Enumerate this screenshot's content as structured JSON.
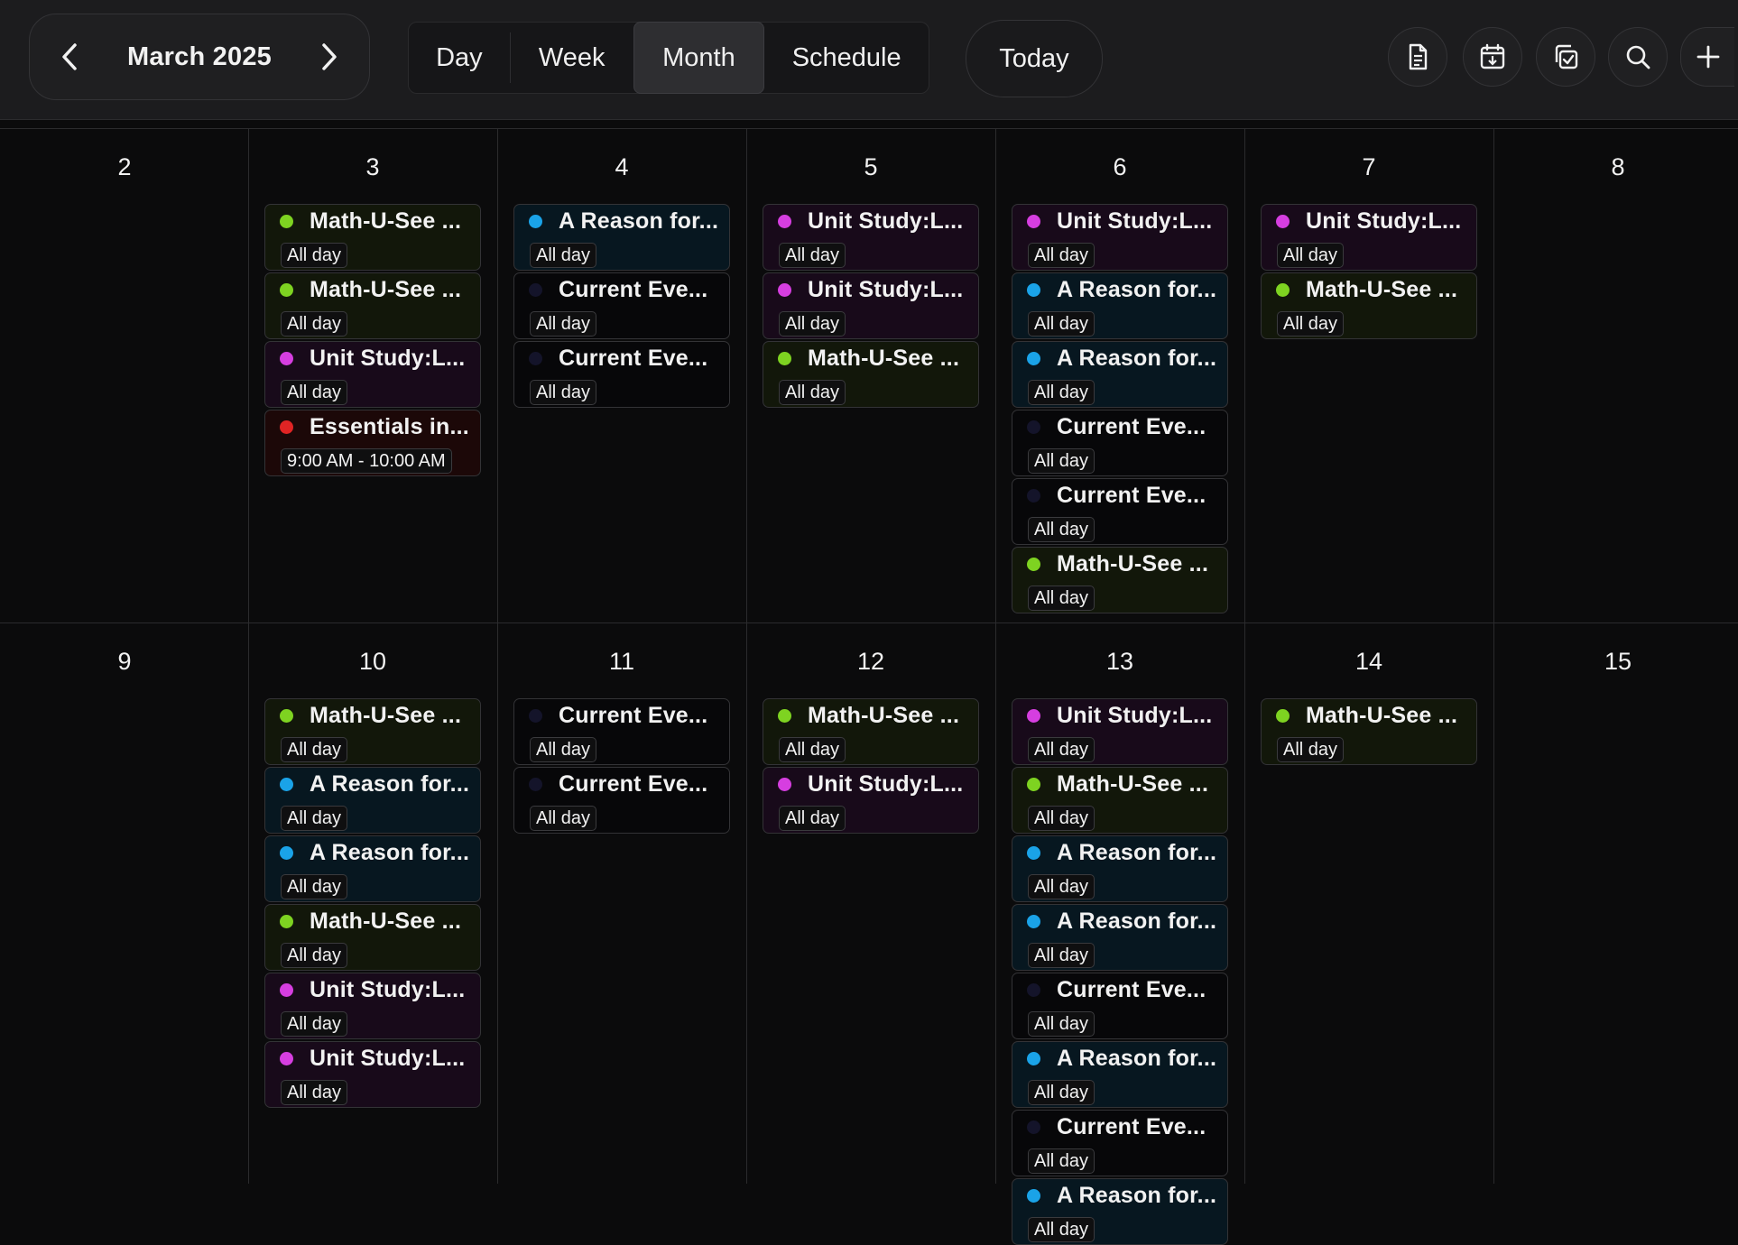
{
  "header": {
    "month_title": "March 2025",
    "views": [
      {
        "label": "Day",
        "active": false
      },
      {
        "label": "Week",
        "active": false
      },
      {
        "label": "Month",
        "active": true
      },
      {
        "label": "Schedule",
        "active": false
      }
    ],
    "today_label": "Today",
    "icons": [
      "document-icon",
      "calendar-import-icon",
      "copy-check-icon",
      "search-icon",
      "plus-icon"
    ]
  },
  "colors": {
    "green": "#7ed321",
    "blue": "#1aa3e8",
    "purple": "#d63ee0",
    "dark": "#14142a",
    "red": "#e02424"
  },
  "weeks": [
    {
      "days": [
        {
          "num": "2",
          "events": []
        },
        {
          "num": "3",
          "events": [
            {
              "title": "Math-U-See ...",
              "time": "All day",
              "color": "green"
            },
            {
              "title": "Math-U-See ...",
              "time": "All day",
              "color": "green"
            },
            {
              "title": "Unit Study:L...",
              "time": "All day",
              "color": "purple"
            },
            {
              "title": "Essentials in...",
              "time": "9:00 AM - 10:00 AM",
              "color": "red"
            }
          ]
        },
        {
          "num": "4",
          "events": [
            {
              "title": "A Reason for...",
              "time": "All day",
              "color": "blue"
            },
            {
              "title": "Current Eve...",
              "time": "All day",
              "color": "dark"
            },
            {
              "title": "Current Eve...",
              "time": "All day",
              "color": "dark"
            }
          ]
        },
        {
          "num": "5",
          "events": [
            {
              "title": "Unit Study:L...",
              "time": "All day",
              "color": "purple"
            },
            {
              "title": "Unit Study:L...",
              "time": "All day",
              "color": "purple"
            },
            {
              "title": "Math-U-See ...",
              "time": "All day",
              "color": "green"
            }
          ]
        },
        {
          "num": "6",
          "events": [
            {
              "title": "Unit Study:L...",
              "time": "All day",
              "color": "purple"
            },
            {
              "title": "A Reason for...",
              "time": "All day",
              "color": "blue"
            },
            {
              "title": "A Reason for...",
              "time": "All day",
              "color": "blue"
            },
            {
              "title": "Current Eve...",
              "time": "All day",
              "color": "dark"
            },
            {
              "title": "Current Eve...",
              "time": "All day",
              "color": "dark"
            },
            {
              "title": "Math-U-See ...",
              "time": "All day",
              "color": "green"
            }
          ]
        },
        {
          "num": "7",
          "events": [
            {
              "title": "Unit Study:L...",
              "time": "All day",
              "color": "purple"
            },
            {
              "title": "Math-U-See ...",
              "time": "All day",
              "color": "green"
            }
          ]
        },
        {
          "num": "8",
          "events": []
        }
      ]
    },
    {
      "days": [
        {
          "num": "9",
          "events": []
        },
        {
          "num": "10",
          "events": [
            {
              "title": "Math-U-See ...",
              "time": "All day",
              "color": "green"
            },
            {
              "title": "A Reason for...",
              "time": "All day",
              "color": "blue"
            },
            {
              "title": "A Reason for...",
              "time": "All day",
              "color": "blue"
            },
            {
              "title": "Math-U-See ...",
              "time": "All day",
              "color": "green"
            },
            {
              "title": "Unit Study:L...",
              "time": "All day",
              "color": "purple"
            },
            {
              "title": "Unit Study:L...",
              "time": "All day",
              "color": "purple"
            }
          ]
        },
        {
          "num": "11",
          "events": [
            {
              "title": "Current Eve...",
              "time": "All day",
              "color": "dark"
            },
            {
              "title": "Current Eve...",
              "time": "All day",
              "color": "dark"
            }
          ]
        },
        {
          "num": "12",
          "events": [
            {
              "title": "Math-U-See ...",
              "time": "All day",
              "color": "green"
            },
            {
              "title": "Unit Study:L...",
              "time": "All day",
              "color": "purple"
            }
          ]
        },
        {
          "num": "13",
          "events": [
            {
              "title": "Unit Study:L...",
              "time": "All day",
              "color": "purple"
            },
            {
              "title": "Math-U-See ...",
              "time": "All day",
              "color": "green"
            },
            {
              "title": "A Reason for...",
              "time": "All day",
              "color": "blue"
            },
            {
              "title": "A Reason for...",
              "time": "All day",
              "color": "blue"
            },
            {
              "title": "Current Eve...",
              "time": "All day",
              "color": "dark"
            },
            {
              "title": "A Reason for...",
              "time": "All day",
              "color": "blue"
            },
            {
              "title": "Current Eve...",
              "time": "All day",
              "color": "dark"
            },
            {
              "title": "A Reason for...",
              "time": "All day",
              "color": "blue"
            }
          ]
        },
        {
          "num": "14",
          "events": [
            {
              "title": "Math-U-See ...",
              "time": "All day",
              "color": "green"
            }
          ]
        },
        {
          "num": "15",
          "events": []
        }
      ]
    }
  ]
}
